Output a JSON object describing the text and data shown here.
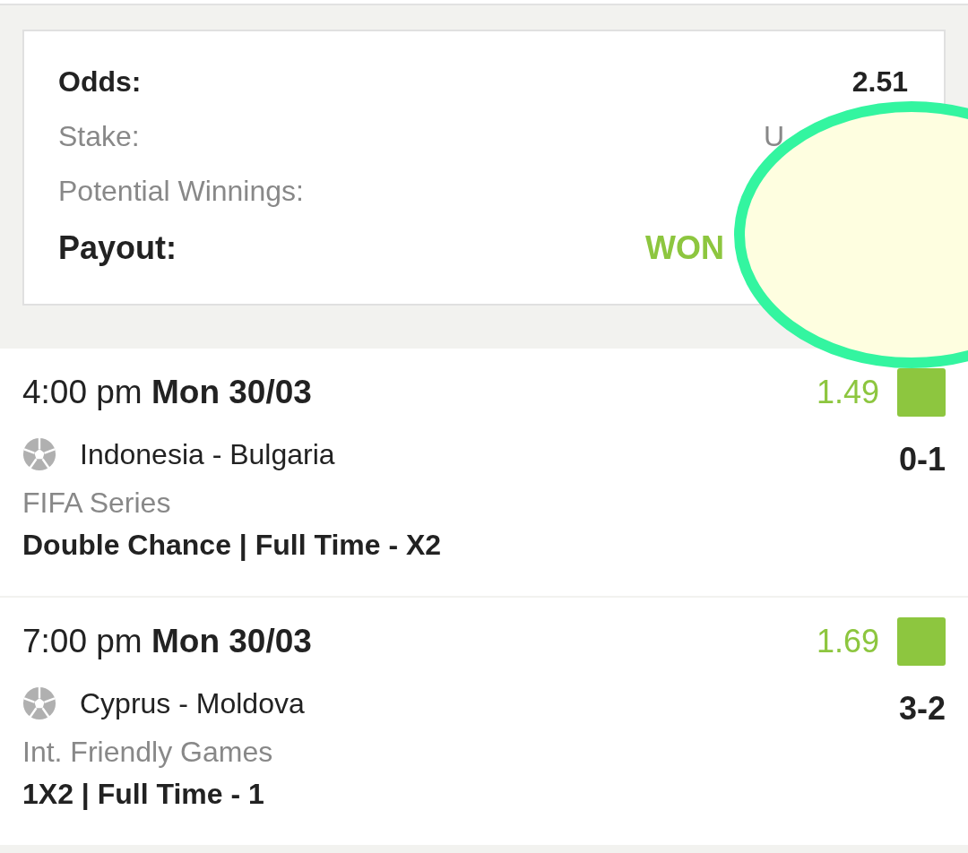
{
  "summary": {
    "rows": [
      {
        "label": "Odds:",
        "value": "2.51",
        "kind": "bold"
      },
      {
        "label": "Stake:",
        "value": "U",
        "kind": "plain"
      },
      {
        "label": "Potential Winnings:",
        "kind": "plain"
      },
      {
        "label": "Payout:",
        "value": "WON",
        "kind": "status"
      }
    ]
  },
  "matches": [
    {
      "time": "4:00 pm **Mon 30/03**",
      "odds": "1.49",
      "color": "#8dc63f",
      "teams": "Indonesia - Bulgaria",
      "score": "0-1",
      "league": "FIFA Series",
      "market": "Double Chance | Full Time - X2"
    },
    {
      "time": "7:00 pm **Mon 30/03**",
      "odds": "1.69",
      "color": "#8dc63f",
      "teams": "Cyprus - Moldova",
      "score": "3-2",
      "league": "Int. Friendly Games",
      "market": "1X2 | Full Time - 1"
    }
  ]
}
